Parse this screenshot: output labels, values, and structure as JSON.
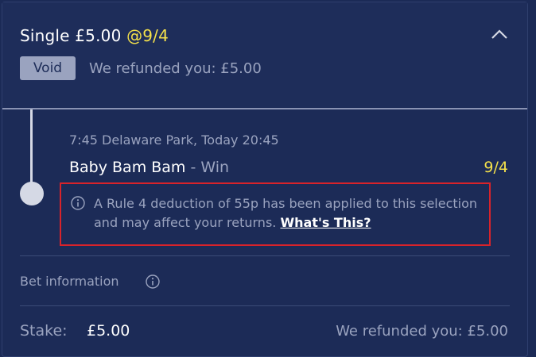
{
  "bet": {
    "title": "Single £5.00",
    "title_odds": "@9/4",
    "status_badge": "Void",
    "refund_text": "We refunded you: £5.00"
  },
  "selection": {
    "event_meta": "7:45 Delaware Park, Today 20:45",
    "horse": "Baby Bam Bam",
    "market": " - Win",
    "odds": "9/4"
  },
  "rule4": {
    "message": "A Rule 4 deduction of 55p has been applied to this selection and may affect your returns. ",
    "link_label": "What's This?"
  },
  "bet_info": {
    "label": "Bet information"
  },
  "footer": {
    "stake_label": "Stake:",
    "stake_value": "£5.00",
    "refund_text": "We refunded you: £5.00"
  },
  "colors": {
    "background": "#1c2b57",
    "odds_yellow": "#f3e04b",
    "muted_text": "#9aa3bf",
    "highlight_red": "#d8232a",
    "void_badge": "#9aa3bf"
  },
  "icons": {
    "collapse": "chevron-up-icon",
    "info": "info-icon"
  }
}
